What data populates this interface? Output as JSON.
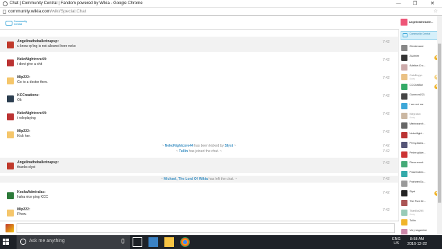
{
  "window": {
    "title": "Chat | Community Central | Fandom powered by Wikia - Google Chrome"
  },
  "address": {
    "host": "community.wikia.com",
    "path": "/wiki/Special:Chat"
  },
  "header": {
    "logo_text": "Community Central"
  },
  "messages": [
    {
      "user": "Angelinatheballerinapup:",
      "text": "u know rp'ing is not allowed here neko",
      "time": "7:42",
      "avatar": "#c0392b"
    },
    {
      "user": "NekoNightcore44:",
      "text": "i dont give a shit",
      "time": "7:42",
      "avatar": "#b33"
    },
    {
      "user": "Mlp222:",
      "text": "Go to a doctor then.",
      "time": "7:42",
      "avatar": "#f5c66b"
    },
    {
      "user": "KCCreations:",
      "text": "Ok",
      "time": "7:42",
      "avatar": "#2c3e50"
    },
    {
      "user": "NekoNightcore44:",
      "text": "i roleplaying",
      "time": "7:42",
      "avatar": "#b33"
    },
    {
      "user": "Mlp222:",
      "text": "Kick her.",
      "time": "7:42",
      "avatar": "#f5c66b"
    },
    {
      "user": "Angelinatheballerinapup:",
      "text": "thanks slyst",
      "time": "7:42",
      "avatar": "#c0392b"
    },
    {
      "user": "KockaAdmiralac:",
      "text": "haha nice ping KCC",
      "time": "7:42",
      "avatar": "#2d7a3a"
    },
    {
      "user": "Mlp222:",
      "text": "Phew.",
      "time": "7:42",
      "avatar": "#f5c66b"
    }
  ],
  "events": {
    "kick": {
      "name": "NekoNightcore44",
      "mid": " has been kicked by ",
      "by": "Slyst",
      "time": "7:42"
    },
    "join": {
      "name": "Tullin",
      "rest": " has joined the chat.",
      "time": "7:42"
    },
    "leave": {
      "name": "Michael, The Lord Of Wikia",
      "rest": " has left the chat.",
      "time": "7:42"
    }
  },
  "userlist": {
    "me": "Angelinatheballe...",
    "room": "Community Central",
    "users": [
      {
        "name": "22ndemand",
        "away": "",
        "color": "#888",
        "mod": false
      },
      {
        "name": "2Admire",
        "away": "",
        "color": "#333",
        "mod": true
      },
      {
        "name": "Adelina Cro...",
        "away": "",
        "color": "#caa",
        "mod": false
      },
      {
        "name": "CatsBoyyn",
        "away": "Away",
        "color": "#d93",
        "mod": true
      },
      {
        "name": "CCChatBot",
        "away": "",
        "color": "#3a6",
        "mod": true
      },
      {
        "name": "Gunmont221",
        "away": "",
        "color": "#444",
        "mod": false
      },
      {
        "name": "I am not me",
        "away": "",
        "color": "#3da7d8",
        "mod": false
      },
      {
        "name": "Kittyraton",
        "away": "Away",
        "color": "#a86",
        "mod": false
      },
      {
        "name": "Markusandr...",
        "away": "",
        "color": "#666",
        "mod": false
      },
      {
        "name": "NekoNight...",
        "away": "",
        "color": "#b33",
        "mod": false
      },
      {
        "name": "PercyJacks...",
        "away": "",
        "color": "#557",
        "mod": false
      },
      {
        "name": "Peter spider...",
        "away": "",
        "color": "#c33",
        "mod": false
      },
      {
        "name": "Piece emnk",
        "away": "",
        "color": "#4a7",
        "mod": false
      },
      {
        "name": "PolarGoblin...",
        "away": "",
        "color": "#3aa",
        "mod": false
      },
      {
        "name": "PusheenGu...",
        "away": "",
        "color": "#999",
        "mod": false
      },
      {
        "name": "Slyst",
        "away": "",
        "color": "#222",
        "mod": true
      },
      {
        "name": "The Pure Dr...",
        "away": "",
        "color": "#a55",
        "mod": false
      },
      {
        "name": "TitanBot295",
        "away": "Away",
        "color": "#5a8",
        "mod": false
      },
      {
        "name": "Tullin",
        "away": "",
        "color": "#f0b429",
        "mod": false
      },
      {
        "name": "Very kagamine",
        "away": "",
        "color": "#c8a",
        "mod": false
      }
    ]
  },
  "taskbar": {
    "search_placeholder": "Ask me anything",
    "lang_top": "ENG",
    "lang_bottom": "US",
    "time": "8:58 AM",
    "date": "2016-12-22"
  },
  "colors": {
    "accent": "#3da7d8",
    "mod_badge": "#f0b429",
    "taskbar": "#1e2228"
  }
}
